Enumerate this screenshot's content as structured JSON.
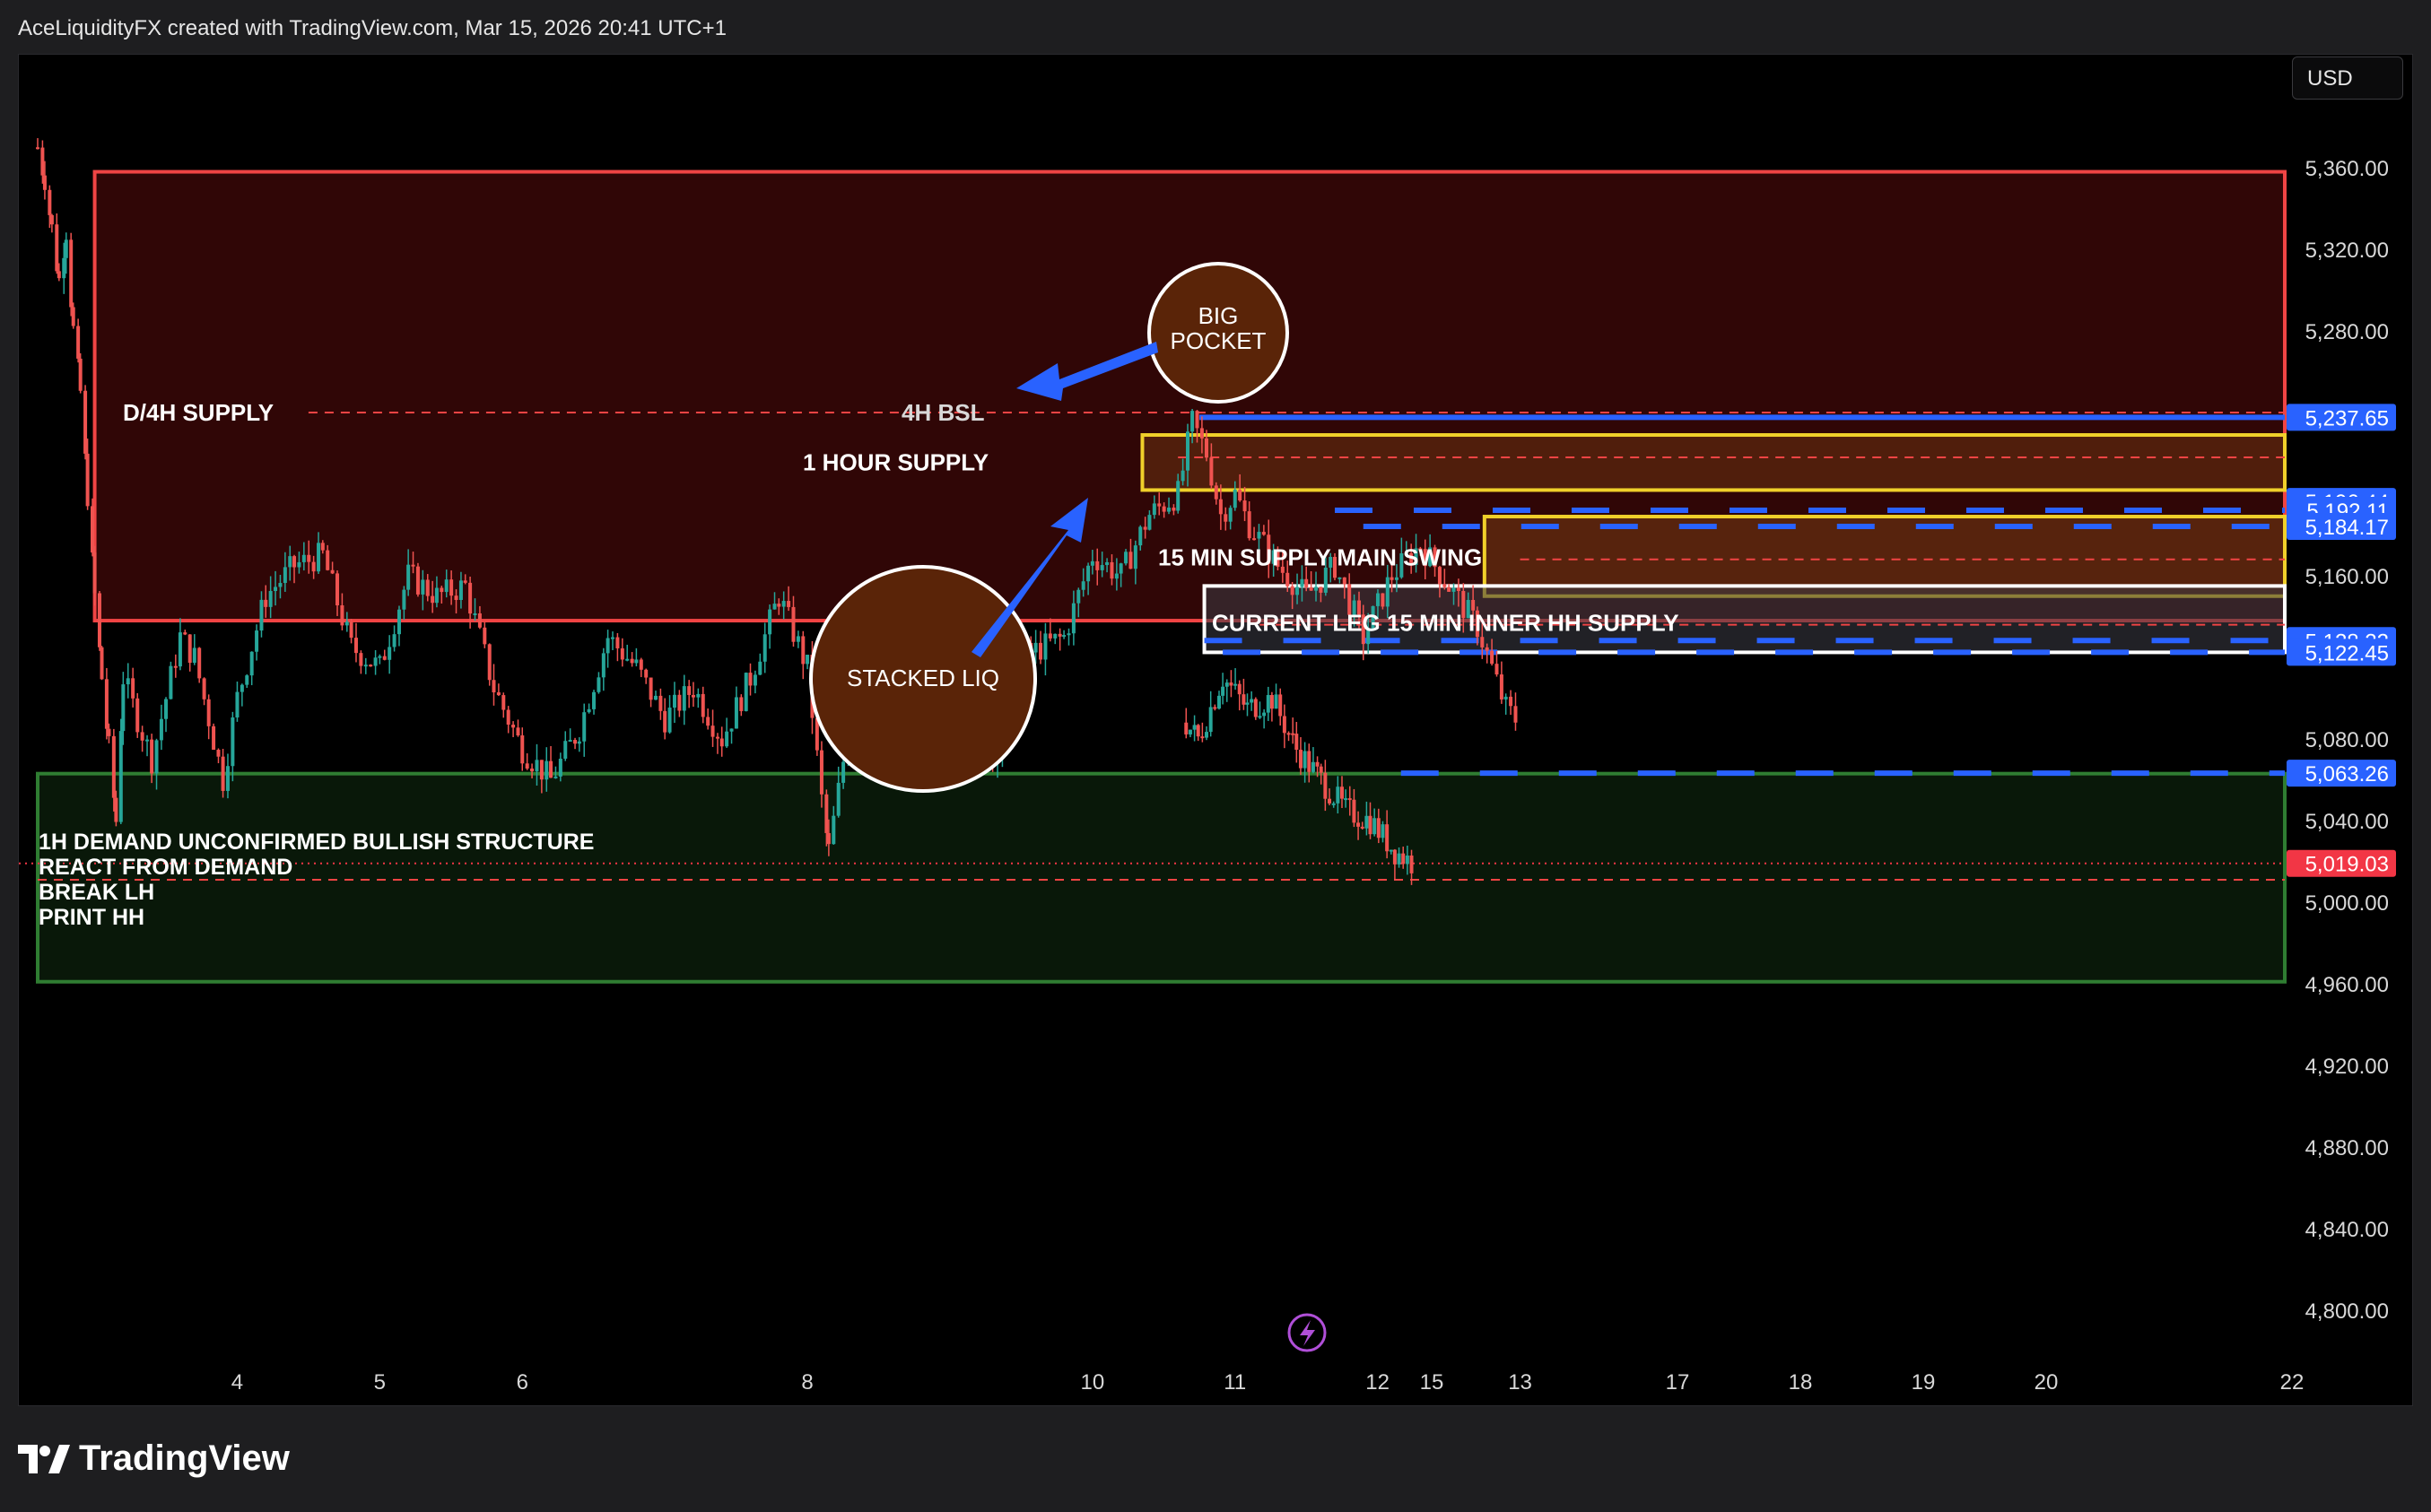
{
  "header": {
    "attribution": "AceLiquidityFX created with TradingView.com, Mar 15, 2026 20:41 UTC+1"
  },
  "currency": "USD",
  "footer": {
    "brand": "TradingView"
  },
  "colors": {
    "supply": "#f04444",
    "demand": "#2f7d32",
    "one_hour": "#f0d02a",
    "liquidity": "#2962ff",
    "current_price": "#f23645"
  },
  "annotations": {
    "d4h_supply": "D/4H SUPPLY",
    "bsl_4h": "4H BSL",
    "one_hour_supply": "1 HOUR SUPPLY",
    "min15_supply": "15 MIN SUPPLY MAIN SWING",
    "current_leg": "CURRENT LEG 15 MIN INNER HH SUPPLY",
    "demand_lines": [
      "1H DEMAND UNCONFIRMED BULLISH STRUCTURE",
      "REACT FROM DEMAND",
      "BREAK LH",
      "PRINT HH"
    ],
    "stacked_liq": "STACKED LIQ",
    "big_pocket": [
      "BIG",
      "POCKET"
    ]
  },
  "chart_data": {
    "type": "line",
    "title": "",
    "xlabel": "",
    "ylabel": "",
    "ylim": [
      4780,
      5390
    ],
    "y_ticks": [
      "5,360.00",
      "5,320.00",
      "5,280.00",
      "5,240.00",
      "5,200.00",
      "5,160.00",
      "5,120.00",
      "5,080.00",
      "5,040.00",
      "5,000.00",
      "4,960.00",
      "4,920.00",
      "4,880.00",
      "4,840.00",
      "4,800.00"
    ],
    "x_ticks": [
      {
        "label": "4",
        "day": 4
      },
      {
        "label": "5",
        "day": 5
      },
      {
        "label": "6",
        "day": 6
      },
      {
        "label": "8",
        "day": 8
      },
      {
        "label": "10",
        "day": 10
      },
      {
        "label": "11",
        "day": 11
      },
      {
        "label": "12",
        "day": 12
      },
      {
        "label": "13",
        "day": 13
      },
      {
        "label": "15",
        "day": 15
      },
      {
        "label": "17",
        "day": 17
      },
      {
        "label": "18",
        "day": 18
      },
      {
        "label": "19",
        "day": 19
      },
      {
        "label": "20",
        "day": 20
      },
      {
        "label": "22",
        "day": 22
      }
    ],
    "price_labels": [
      {
        "text": "5,237.65",
        "value": 5237.65,
        "color": "#2962ff"
      },
      {
        "text": "5,196.44",
        "value": 5196.44,
        "color": "#2962ff"
      },
      {
        "text": "5,192.11",
        "value": 5192.11,
        "color": "#2962ff"
      },
      {
        "text": "5,184.17",
        "value": 5184.17,
        "color": "#2962ff"
      },
      {
        "text": "5,128.22",
        "value": 5128.22,
        "color": "#2962ff"
      },
      {
        "text": "5,122.45",
        "value": 5122.45,
        "color": "#2962ff"
      },
      {
        "text": "5,063.26",
        "value": 5063.26,
        "color": "#2962ff"
      },
      {
        "text": "5,019.03",
        "value": 5019.03,
        "color": "#f23645"
      }
    ],
    "series": [
      {
        "values": [
          [
            2.6,
            5370
          ],
          [
            2.65,
            5355
          ],
          [
            2.7,
            5330
          ],
          [
            2.75,
            5305
          ],
          [
            2.8,
            5330
          ],
          [
            2.85,
            5280
          ],
          [
            2.9,
            5250
          ],
          [
            2.95,
            5200
          ],
          [
            3.0,
            5150
          ],
          [
            3.05,
            5110
          ],
          [
            3.1,
            5075
          ],
          [
            3.15,
            5040
          ],
          [
            3.2,
            5110
          ],
          [
            3.3,
            5090
          ],
          [
            3.4,
            5070
          ],
          [
            3.5,
            5100
          ],
          [
            3.6,
            5130
          ],
          [
            3.7,
            5120
          ],
          [
            3.8,
            5090
          ],
          [
            3.9,
            5060
          ],
          [
            4.0,
            5100
          ],
          [
            4.2,
            5150
          ],
          [
            4.4,
            5165
          ],
          [
            4.6,
            5170
          ],
          [
            4.8,
            5125
          ],
          [
            5.0,
            5115
          ],
          [
            5.2,
            5160
          ],
          [
            5.4,
            5150
          ],
          [
            5.6,
            5155
          ],
          [
            5.8,
            5105
          ],
          [
            6.0,
            5075
          ],
          [
            6.2,
            5060
          ],
          [
            6.4,
            5085
          ],
          [
            6.6,
            5130
          ],
          [
            6.8,
            5115
          ],
          [
            7.0,
            5090
          ],
          [
            7.2,
            5105
          ],
          [
            7.4,
            5080
          ],
          [
            7.6,
            5110
          ],
          [
            7.8,
            5150
          ],
          [
            8.0,
            5115
          ],
          [
            8.1,
            5050
          ],
          [
            8.15,
            5025
          ],
          [
            8.3,
            5090
          ],
          [
            8.5,
            5095
          ],
          [
            8.7,
            5110
          ],
          [
            8.9,
            5085
          ],
          [
            9.1,
            5110
          ],
          [
            9.3,
            5070
          ],
          [
            9.5,
            5120
          ],
          [
            9.8,
            5130
          ],
          [
            10.0,
            5170
          ],
          [
            10.2,
            5160
          ],
          [
            10.4,
            5190
          ],
          [
            10.6,
            5200
          ],
          [
            10.7,
            5235
          ],
          [
            10.8,
            5220
          ],
          [
            10.9,
            5190
          ],
          [
            11.0,
            5200
          ],
          [
            11.1,
            5185
          ],
          [
            11.3,
            5165
          ],
          [
            11.5,
            5150
          ],
          [
            11.7,
            5165
          ],
          [
            11.9,
            5130
          ],
          [
            12.1,
            5160
          ],
          [
            12.3,
            5175
          ],
          [
            12.5,
            5155
          ],
          [
            12.7,
            5135
          ],
          [
            12.9,
            5095
          ],
          [
            13.1,
            5080
          ],
          [
            13.3,
            5110
          ],
          [
            13.5,
            5095
          ],
          [
            13.7,
            5100
          ],
          [
            13.9,
            5075
          ],
          [
            14.1,
            5060
          ],
          [
            14.3,
            5045
          ],
          [
            14.5,
            5040
          ],
          [
            14.7,
            5025
          ],
          [
            14.85,
            5019
          ]
        ]
      }
    ]
  }
}
